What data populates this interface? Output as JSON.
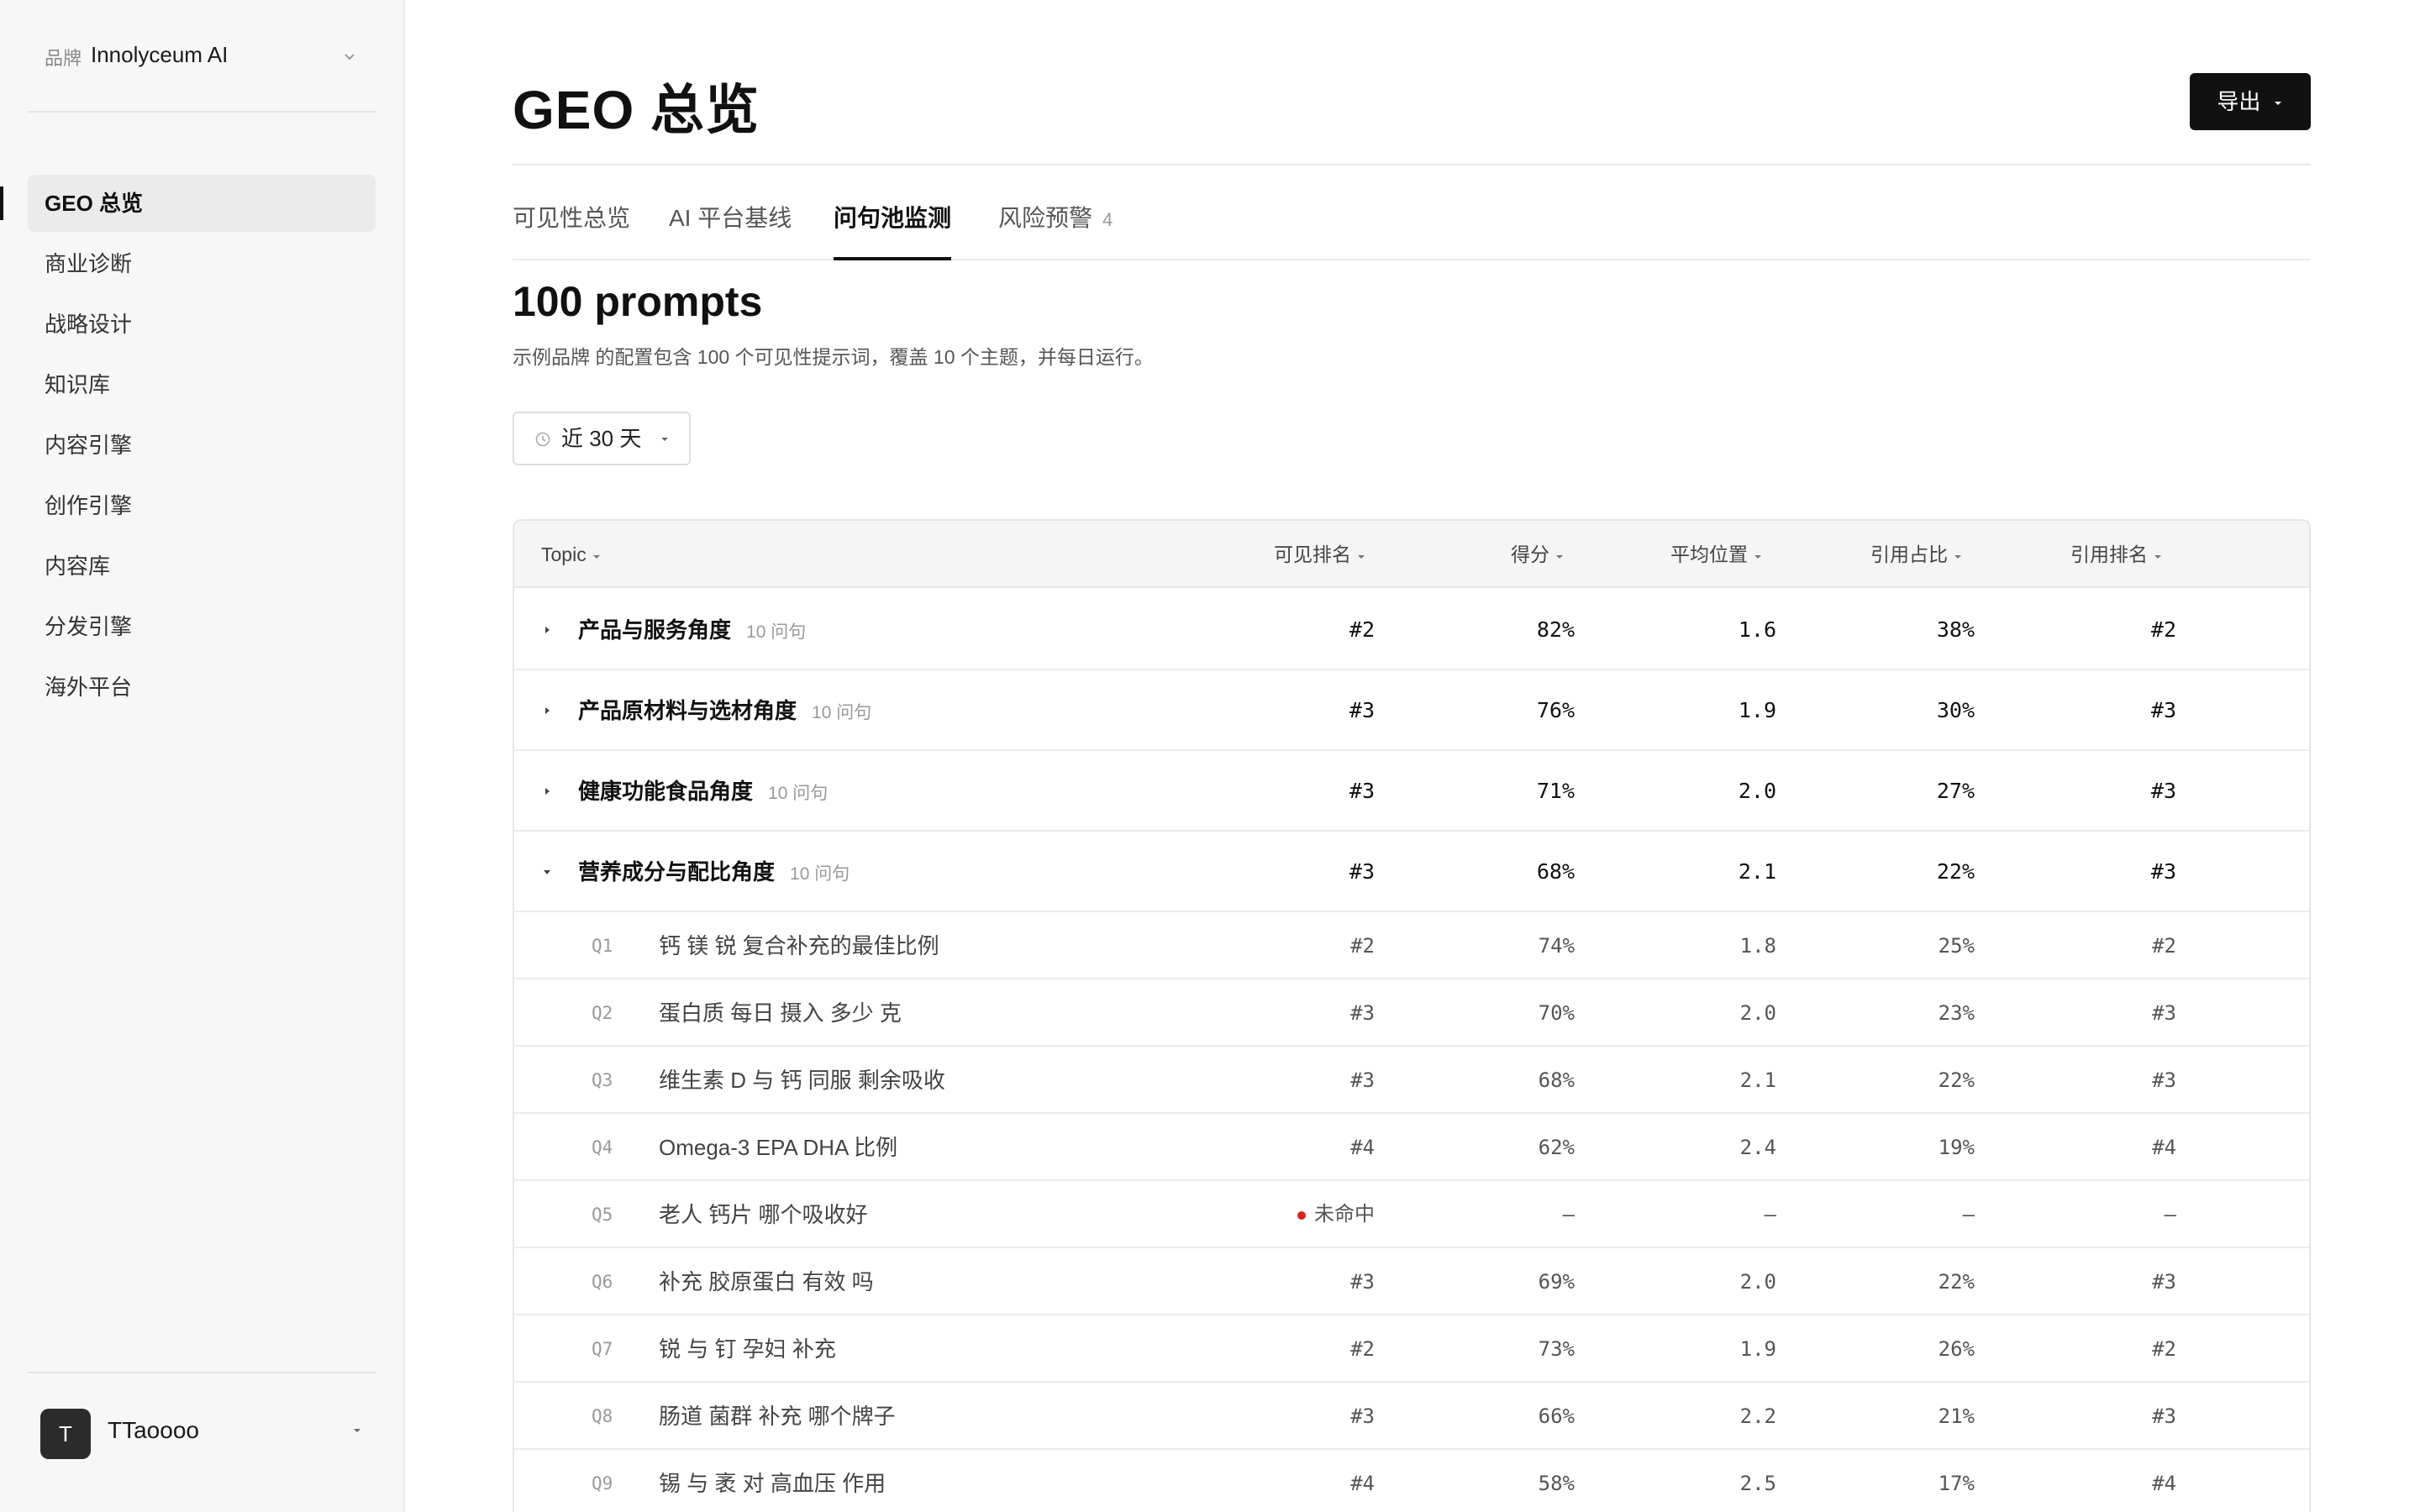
{
  "brand": {
    "label": "品牌",
    "name": "Innolyceum AI"
  },
  "nav": [
    {
      "label": "GEO 总览",
      "active": true
    },
    {
      "label": "商业诊断"
    },
    {
      "label": "战略设计"
    },
    {
      "label": "知识库"
    },
    {
      "label": "内容引擎"
    },
    {
      "label": "创作引擎"
    },
    {
      "label": "内容库"
    },
    {
      "label": "分发引擎"
    },
    {
      "label": "海外平台"
    }
  ],
  "user": {
    "initial": "T",
    "name": "TTaoooo"
  },
  "page": {
    "title": "GEO 总览",
    "export_label": "导出"
  },
  "tabs": [
    {
      "label": "可见性总览"
    },
    {
      "label": "AI 平台基线"
    },
    {
      "label": "问句池监测",
      "active": true
    },
    {
      "label": "风险预警",
      "badge": "4"
    }
  ],
  "section": {
    "title": "100 prompts",
    "description": "示例品牌 的配置包含 100 个可见性提示词，覆盖 10 个主题，并每日运行。",
    "date_range": "近 30 天"
  },
  "table": {
    "headers": [
      "Topic",
      "可见排名",
      "得分",
      "平均位置",
      "引用占比",
      "引用排名"
    ],
    "groups": [
      {
        "name": "产品与服务角度",
        "count": "10 问句",
        "expanded": false,
        "rank": "#2",
        "score": "82%",
        "avg_pos": "1.6",
        "cite_share": "38%",
        "cite_rank": "#2"
      },
      {
        "name": "产品原材料与选材角度",
        "count": "10 问句",
        "expanded": false,
        "rank": "#3",
        "score": "76%",
        "avg_pos": "1.9",
        "cite_share": "30%",
        "cite_rank": "#3"
      },
      {
        "name": "健康功能食品角度",
        "count": "10 问句",
        "expanded": false,
        "rank": "#3",
        "score": "71%",
        "avg_pos": "2.0",
        "cite_share": "27%",
        "cite_rank": "#3"
      },
      {
        "name": "营养成分与配比角度",
        "count": "10 问句",
        "expanded": true,
        "rank": "#3",
        "score": "68%",
        "avg_pos": "2.1",
        "cite_share": "22%",
        "cite_rank": "#3"
      }
    ],
    "questions": [
      {
        "num": "Q1",
        "text": "钙 镁 锐 复合补充的最佳比例",
        "rank": "#2",
        "score": "74%",
        "avg_pos": "1.8",
        "cite_share": "25%",
        "cite_rank": "#2"
      },
      {
        "num": "Q2",
        "text": "蛋白质 每日 摄入 多少 克",
        "rank": "#3",
        "score": "70%",
        "avg_pos": "2.0",
        "cite_share": "23%",
        "cite_rank": "#3"
      },
      {
        "num": "Q3",
        "text": "维生素 D 与 钙 同服 剩余吸收",
        "rank": "#3",
        "score": "68%",
        "avg_pos": "2.1",
        "cite_share": "22%",
        "cite_rank": "#3"
      },
      {
        "num": "Q4",
        "text": "Omega-3 EPA DHA 比例",
        "rank": "#4",
        "score": "62%",
        "avg_pos": "2.4",
        "cite_share": "19%",
        "cite_rank": "#4"
      },
      {
        "num": "Q5",
        "text": "老人 钙片 哪个吸收好",
        "rank": "未命中",
        "missed": true,
        "score": "—",
        "avg_pos": "—",
        "cite_share": "—",
        "cite_rank": "—"
      },
      {
        "num": "Q6",
        "text": "补充 胶原蛋白 有效 吗",
        "rank": "#3",
        "score": "69%",
        "avg_pos": "2.0",
        "cite_share": "22%",
        "cite_rank": "#3"
      },
      {
        "num": "Q7",
        "text": "锐 与 钉 孕妇 补充",
        "rank": "#2",
        "score": "73%",
        "avg_pos": "1.9",
        "cite_share": "26%",
        "cite_rank": "#2"
      },
      {
        "num": "Q8",
        "text": "肠道 菌群 补充 哪个牌子",
        "rank": "#3",
        "score": "66%",
        "avg_pos": "2.2",
        "cite_share": "21%",
        "cite_rank": "#3"
      },
      {
        "num": "Q9",
        "text": "锡 与 袤 对 高血压 作用",
        "rank": "#4",
        "score": "58%",
        "avg_pos": "2.5",
        "cite_share": "17%",
        "cite_rank": "#4"
      }
    ]
  },
  "colors": {
    "accent": "#111111",
    "miss_dot": "#d9231e",
    "sidebar_bg": "#f7f7f7"
  }
}
